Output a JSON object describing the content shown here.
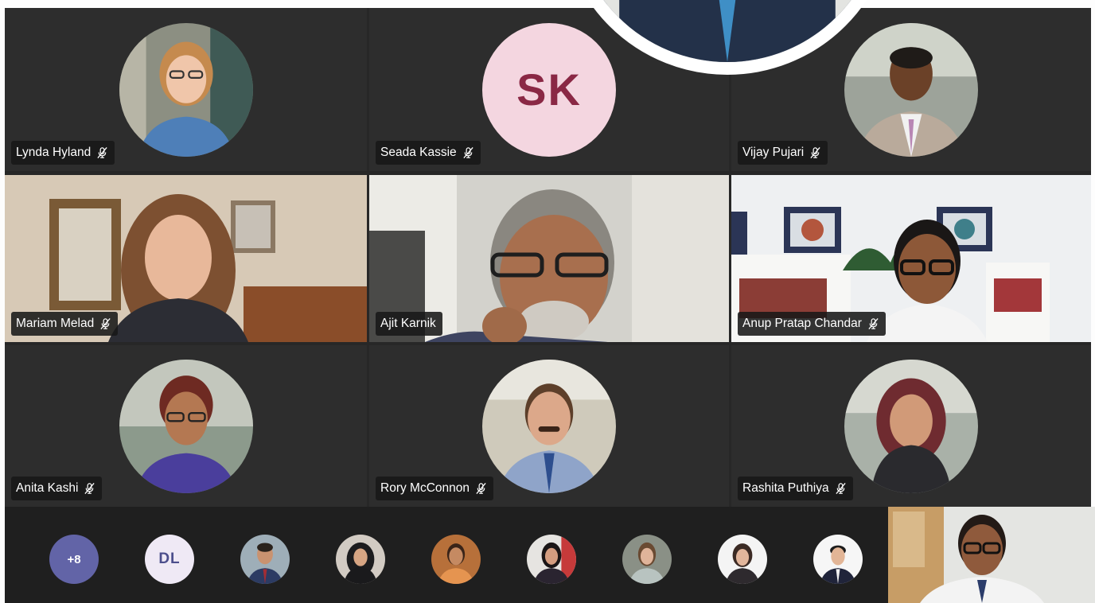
{
  "participants": {
    "lynda": {
      "name": "Lynda Hyland",
      "muted": true
    },
    "seada": {
      "name": "Seada Kassie",
      "initials": "SK",
      "muted": true
    },
    "vijay": {
      "name": "Vijay Pujari",
      "muted": true
    },
    "mariam": {
      "name": "Mariam Melad",
      "muted": true
    },
    "ajit": {
      "name": "Ajit Karnik",
      "muted": false
    },
    "anup": {
      "name": "Anup Pratap Chandar",
      "muted": true
    },
    "anita": {
      "name": "Anita Kashi",
      "muted": true
    },
    "rory": {
      "name": "Rory McConnon",
      "muted": true
    },
    "rashita": {
      "name": "Rashita Puthiya",
      "muted": true
    }
  },
  "participant_strip": {
    "overflow_label": "+8",
    "dl_initials": "DL"
  },
  "colors": {
    "stage_bg": "#272727",
    "tile_bg": "#2d2d2d",
    "name_tag_bg": "#181818",
    "sk_avatar_bg": "#f4d6e0",
    "sk_avatar_text": "#8a2845",
    "overflow_bg": "#6264a7",
    "dl_bg": "#efe9f5",
    "dl_text": "#4c4e8c",
    "bottom_bar_bg": "#1f1f1f",
    "speaker_ring": "#ffffff"
  },
  "icons": {
    "mic_muted": "mic-muted-icon"
  }
}
